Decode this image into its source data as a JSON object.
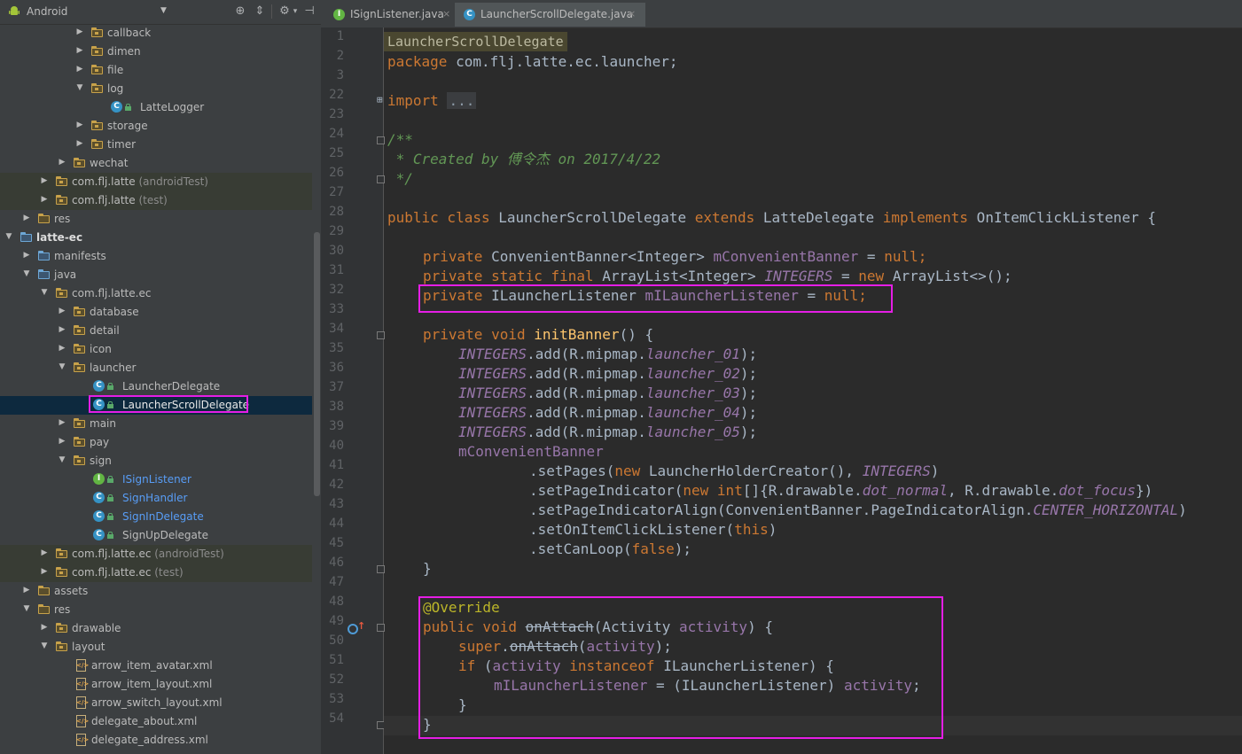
{
  "project_panel": {
    "view_label": "Android",
    "toolbar_icons": [
      "target-icon",
      "collapse-icon",
      "settings-icon",
      "hide-icon"
    ],
    "tree": [
      {
        "label": "callback",
        "depth": 4,
        "kind": "folder",
        "state": "collapsed"
      },
      {
        "label": "dimen",
        "depth": 4,
        "kind": "folder",
        "state": "collapsed"
      },
      {
        "label": "file",
        "depth": 4,
        "kind": "folder",
        "state": "collapsed"
      },
      {
        "label": "log",
        "depth": 4,
        "kind": "folder",
        "state": "expanded"
      },
      {
        "label": "LatteLogger",
        "depth": 6,
        "kind": "class"
      },
      {
        "label": "storage",
        "depth": 4,
        "kind": "folder",
        "state": "collapsed"
      },
      {
        "label": "timer",
        "depth": 4,
        "kind": "folder",
        "state": "collapsed"
      },
      {
        "label": "wechat",
        "depth": 3,
        "kind": "folder",
        "state": "collapsed"
      },
      {
        "label": "com.flj.latte",
        "suffix": " (androidTest)",
        "depth": 2,
        "kind": "folder",
        "state": "collapsed",
        "green": true
      },
      {
        "label": "com.flj.latte",
        "suffix": " (test)",
        "depth": 2,
        "kind": "folder",
        "state": "collapsed",
        "green": true
      },
      {
        "label": "res",
        "depth": 1,
        "kind": "res",
        "state": "collapsed"
      },
      {
        "label": "latte-ec",
        "depth": 0,
        "kind": "module",
        "state": "expanded",
        "bold": true
      },
      {
        "label": "manifests",
        "depth": 1,
        "kind": "blue",
        "state": "collapsed"
      },
      {
        "label": "java",
        "depth": 1,
        "kind": "blue",
        "state": "expanded"
      },
      {
        "label": "com.flj.latte.ec",
        "depth": 2,
        "kind": "folder",
        "state": "expanded"
      },
      {
        "label": "database",
        "depth": 3,
        "kind": "folder",
        "state": "collapsed"
      },
      {
        "label": "detail",
        "depth": 3,
        "kind": "folder",
        "state": "collapsed"
      },
      {
        "label": "icon",
        "depth": 3,
        "kind": "folder",
        "state": "collapsed"
      },
      {
        "label": "launcher",
        "depth": 3,
        "kind": "folder",
        "state": "expanded"
      },
      {
        "label": "LauncherDelegate",
        "depth": 5,
        "kind": "class"
      },
      {
        "label": "LauncherScrollDelegate",
        "depth": 5,
        "kind": "class",
        "selected": true
      },
      {
        "label": "main",
        "depth": 3,
        "kind": "folder",
        "state": "collapsed"
      },
      {
        "label": "pay",
        "depth": 3,
        "kind": "folder",
        "state": "collapsed"
      },
      {
        "label": "sign",
        "depth": 3,
        "kind": "folder",
        "state": "expanded"
      },
      {
        "label": "ISignListener",
        "depth": 5,
        "kind": "interface",
        "blue": true
      },
      {
        "label": "SignHandler",
        "depth": 5,
        "kind": "class",
        "blue": true
      },
      {
        "label": "SignInDelegate",
        "depth": 5,
        "kind": "class",
        "blue": true
      },
      {
        "label": "SignUpDelegate",
        "depth": 5,
        "kind": "class"
      },
      {
        "label": "com.flj.latte.ec",
        "suffix": " (androidTest)",
        "depth": 2,
        "kind": "folder",
        "state": "collapsed",
        "green": true
      },
      {
        "label": "com.flj.latte.ec",
        "suffix": " (test)",
        "depth": 2,
        "kind": "folder",
        "state": "collapsed",
        "green": true
      },
      {
        "label": "assets",
        "depth": 1,
        "kind": "res",
        "state": "collapsed"
      },
      {
        "label": "res",
        "depth": 1,
        "kind": "res",
        "state": "expanded"
      },
      {
        "label": "drawable",
        "depth": 2,
        "kind": "folder",
        "state": "collapsed"
      },
      {
        "label": "layout",
        "depth": 2,
        "kind": "folder",
        "state": "expanded"
      },
      {
        "label": "arrow_item_avatar.xml",
        "depth": 4,
        "kind": "xml"
      },
      {
        "label": "arrow_item_layout.xml",
        "depth": 4,
        "kind": "xml"
      },
      {
        "label": "arrow_switch_layout.xml",
        "depth": 4,
        "kind": "xml"
      },
      {
        "label": "delegate_about.xml",
        "depth": 4,
        "kind": "xml"
      },
      {
        "label": "delegate_address.xml",
        "depth": 4,
        "kind": "xml"
      }
    ]
  },
  "editor": {
    "tabs": [
      {
        "icon": "I",
        "name": "ISignListener.java",
        "active": false
      },
      {
        "icon": "C",
        "name": "LauncherScrollDelegate.java",
        "active": true
      }
    ],
    "breadcrumb": "LauncherScrollDelegate",
    "lines": [
      {
        "n": "1"
      },
      {
        "n": "2"
      },
      {
        "n": "3"
      },
      {
        "n": "22"
      },
      {
        "n": "23"
      },
      {
        "n": "24"
      },
      {
        "n": "25"
      },
      {
        "n": "26"
      },
      {
        "n": "27"
      },
      {
        "n": "28"
      },
      {
        "n": "29"
      },
      {
        "n": "30"
      },
      {
        "n": "31"
      },
      {
        "n": "32"
      },
      {
        "n": "33"
      },
      {
        "n": "34"
      },
      {
        "n": "35"
      },
      {
        "n": "36"
      },
      {
        "n": "37"
      },
      {
        "n": "38"
      },
      {
        "n": "39"
      },
      {
        "n": "40"
      },
      {
        "n": "41"
      },
      {
        "n": "42"
      },
      {
        "n": "43"
      },
      {
        "n": "44"
      },
      {
        "n": "45"
      },
      {
        "n": "46"
      },
      {
        "n": "47"
      },
      {
        "n": "48"
      },
      {
        "n": "49"
      },
      {
        "n": "50"
      },
      {
        "n": "51"
      },
      {
        "n": "52"
      },
      {
        "n": "53"
      },
      {
        "n": "54"
      }
    ],
    "code": {
      "l1_kw": "package",
      "l1_rest": " com.flj.latte.ec.launcher;",
      "l3_kw": "import",
      "l3_fold": "...",
      "l23": "/**",
      "l24": " * Created by 傅令杰 on 2017/4/22",
      "l25": " */",
      "l27_a": "public class",
      "l27_b": " LauncherScrollDelegate ",
      "l27_c": "extends",
      "l27_d": " LatteDelegate ",
      "l27_e": "implements",
      "l27_f": " OnItemClickListener {",
      "l29_a": "private",
      "l29_b": " ConvenientBanner<Integer> ",
      "l29_c": "mConvenientBanner",
      "l29_d": " = ",
      "l29_e": "null",
      "l29_f": ";",
      "l30_a": "private static final",
      "l30_b": " ArrayList<Integer> ",
      "l30_c": "INTEGERS",
      "l30_d": " = ",
      "l30_e": "new",
      "l30_f": " ArrayList<>();",
      "l31_a": "private",
      "l31_b": " ILauncherListener ",
      "l31_c": "mILauncherListener",
      "l31_d": " = ",
      "l31_e": "null",
      "l31_f": ";",
      "l33_a": "private void",
      "l33_b": " ",
      "l33_c": "initBanner",
      "l33_d": "() {",
      "l34_a": "INTEGERS",
      "l34_b": ".add(R.mipmap.",
      "l34_c": "launcher_01",
      "l34_d": ");",
      "l35_a": "INTEGERS",
      "l35_b": ".add(R.mipmap.",
      "l35_c": "launcher_02",
      "l35_d": ");",
      "l36_a": "INTEGERS",
      "l36_b": ".add(R.mipmap.",
      "l36_c": "launcher_03",
      "l36_d": ");",
      "l37_a": "INTEGERS",
      "l37_b": ".add(R.mipmap.",
      "l37_c": "launcher_04",
      "l37_d": ");",
      "l38_a": "INTEGERS",
      "l38_b": ".add(R.mipmap.",
      "l38_c": "launcher_05",
      "l38_d": ");",
      "l39": "mConvenientBanner",
      "l40_a": ".setPages(",
      "l40_b": "new",
      "l40_c": " LauncherHolderCreator(), ",
      "l40_d": "INTEGERS",
      "l40_e": ")",
      "l41_a": ".setPageIndicator(",
      "l41_b": "new int",
      "l41_c": "[]{R.drawable.",
      "l41_d": "dot_normal",
      "l41_e": ", R.drawable.",
      "l41_f": "dot_focus",
      "l41_g": "})",
      "l42_a": ".setPageIndicatorAlign(ConvenientBanner.PageIndicatorAlign.",
      "l42_b": "CENTER_HORIZONTAL",
      "l42_c": ")",
      "l43_a": ".setOnItemClickListener(",
      "l43_b": "this",
      "l43_c": ")",
      "l44_a": ".setCanLoop(",
      "l44_b": "false",
      "l44_c": ");",
      "l45": "}",
      "l47": "@Override",
      "l48_a": "public void",
      "l48_b": " ",
      "l48_c": "onAttach",
      "l48_d": "(Activity ",
      "l48_e": "activity",
      "l48_f": ") {",
      "l49_a": "super",
      "l49_b": ".",
      "l49_c": "onAttach",
      "l49_d": "(",
      "l49_e": "activity",
      "l49_f": ");",
      "l50_a": "if",
      "l50_b": " (",
      "l50_c": "activity",
      "l50_d": " ",
      "l50_e": "instanceof",
      "l50_f": " ILauncherListener) {",
      "l51_a": "mILauncherListener",
      "l51_b": " = (ILauncherListener) ",
      "l51_c": "activity",
      "l51_d": ";",
      "l52": "}",
      "l53": "}"
    }
  },
  "colors": {
    "highlight_box": "#e51ee5",
    "keyword": "#cc7832",
    "field": "#9876aa",
    "method": "#ffc66d",
    "comment": "#629755",
    "annotation": "#bbb529"
  }
}
